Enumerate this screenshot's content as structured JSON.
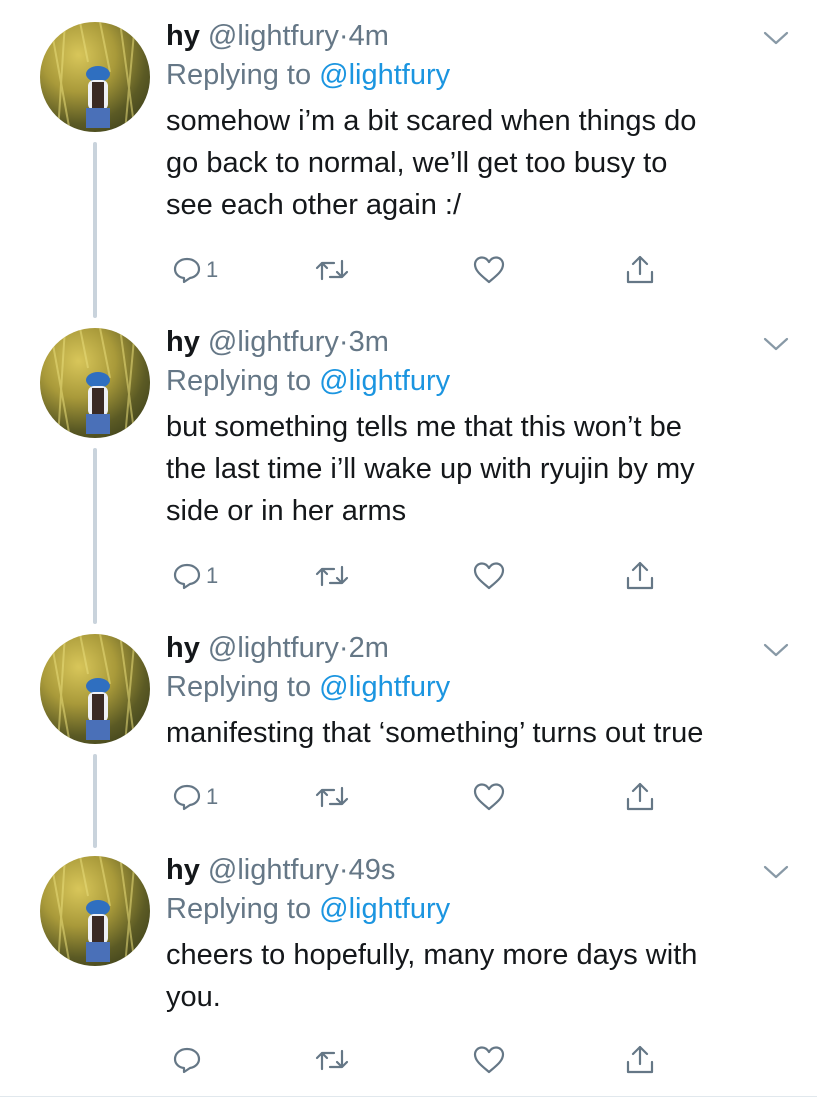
{
  "colors": {
    "text": "#14171a",
    "muted": "#657786",
    "link": "#1b95e0",
    "thread_line": "#c9d3dc"
  },
  "tweets": [
    {
      "name": "hy",
      "handle": "@lightfury",
      "dot": "·",
      "time": "4m",
      "replying_prefix": "Replying to ",
      "replying_to": "@lightfury",
      "text": "somehow i’m a bit scared when things do\ngo back to normal, we’ll get too busy to\nsee each other again :/",
      "reply_count": "1",
      "icons": [
        "reply-icon",
        "retweet-icon",
        "like-icon",
        "share-icon"
      ]
    },
    {
      "name": "hy",
      "handle": "@lightfury",
      "dot": "·",
      "time": "3m",
      "replying_prefix": "Replying to ",
      "replying_to": "@lightfury",
      "text": "but something tells me that this won’t be\nthe last time i’ll wake up with ryujin by my\nside or in her arms",
      "reply_count": "1",
      "icons": [
        "reply-icon",
        "retweet-icon",
        "like-icon",
        "share-icon"
      ]
    },
    {
      "name": "hy",
      "handle": "@lightfury",
      "dot": "·",
      "time": "2m",
      "replying_prefix": "Replying to ",
      "replying_to": "@lightfury",
      "text": "manifesting that ‘something’ turns out true",
      "reply_count": "1",
      "icons": [
        "reply-icon",
        "retweet-icon",
        "like-icon",
        "share-icon"
      ]
    },
    {
      "name": "hy",
      "handle": "@lightfury",
      "dot": "·",
      "time": "49s",
      "replying_prefix": "Replying to ",
      "replying_to": "@lightfury",
      "text": "cheers to hopefully, many more days with\nyou.",
      "reply_count": "",
      "icons": [
        "reply-icon",
        "retweet-icon",
        "like-icon",
        "share-icon"
      ]
    }
  ]
}
